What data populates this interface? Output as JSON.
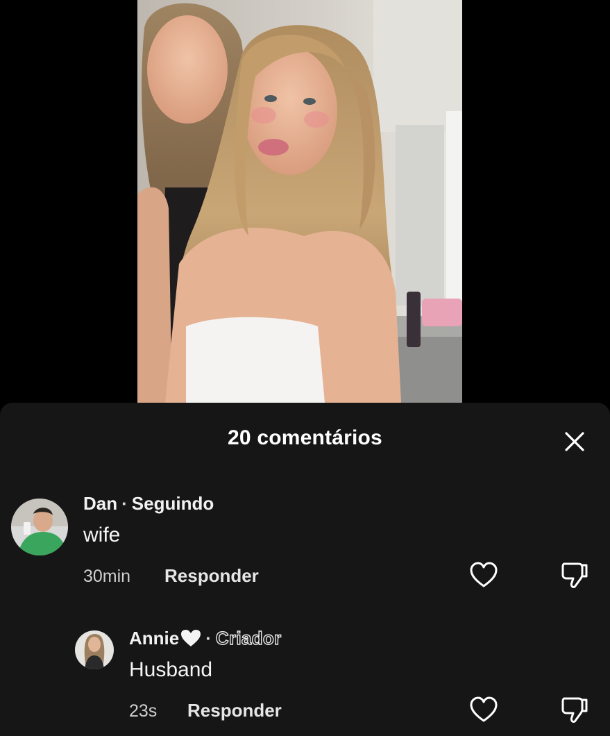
{
  "video": {
    "content": "selfie-video-frame"
  },
  "comments_sheet": {
    "title": "20 comentários",
    "close_icon": "close-icon",
    "comments": [
      {
        "author": "Dan",
        "separator": "·",
        "status": "Seguindo",
        "text": "wife",
        "time": "30min",
        "reply_label": "Responder",
        "like_icon": "heart-outline-icon",
        "dislike_icon": "thumbs-down-icon"
      },
      {
        "author": "Annie",
        "author_emoji_icon": "white-heart-icon",
        "separator": "·",
        "status": "Criador",
        "text": "Husband",
        "time": "23s",
        "reply_label": "Responder",
        "like_icon": "heart-outline-icon",
        "dislike_icon": "thumbs-down-icon"
      }
    ]
  },
  "colors": {
    "background": "#000000",
    "sheet": "#161616",
    "text": "#ffffff",
    "secondary_text": "#cfcfcf"
  }
}
